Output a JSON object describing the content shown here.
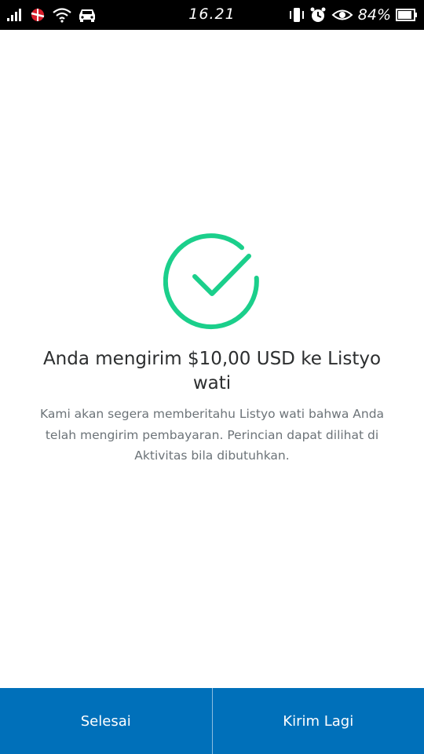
{
  "status_bar": {
    "time": "16.21",
    "battery_text": "84%",
    "icons_left": [
      "signal-icon",
      "carrier-icon",
      "wifi-icon",
      "car-mode-icon"
    ],
    "icons_right": [
      "vibrate-icon",
      "alarm-icon",
      "eye-icon",
      "battery-icon"
    ]
  },
  "success": {
    "icon": "check-circle-icon",
    "color": "#1bcf8b"
  },
  "title": "Anda mengirim $10,00 USD ke Listyo wati",
  "message": "Kami akan segera memberitahu Listyo wati bahwa Anda telah mengirim pembayaran. Perincian dapat dilihat di Aktivitas bila dibutuhkan.",
  "actions": {
    "done_label": "Selesai",
    "send_again_label": "Kirim Lagi",
    "background": "#0070ba"
  }
}
